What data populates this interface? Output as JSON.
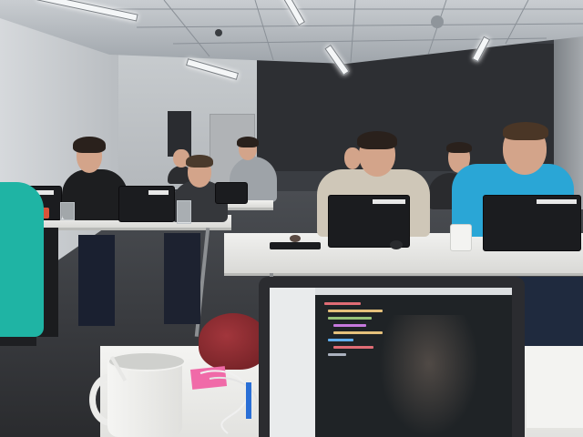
{
  "scene": {
    "description_kind": "photo",
    "colors": {
      "ceiling": "#b5babf",
      "dark_wall": "#2d2f33",
      "desk": "#e9e9e6",
      "teal_shirt": "#1fb4a4",
      "blue_shirt": "#2aa6d6",
      "hat": "#8c2a30",
      "sticky_note": "#f06aa8"
    }
  }
}
